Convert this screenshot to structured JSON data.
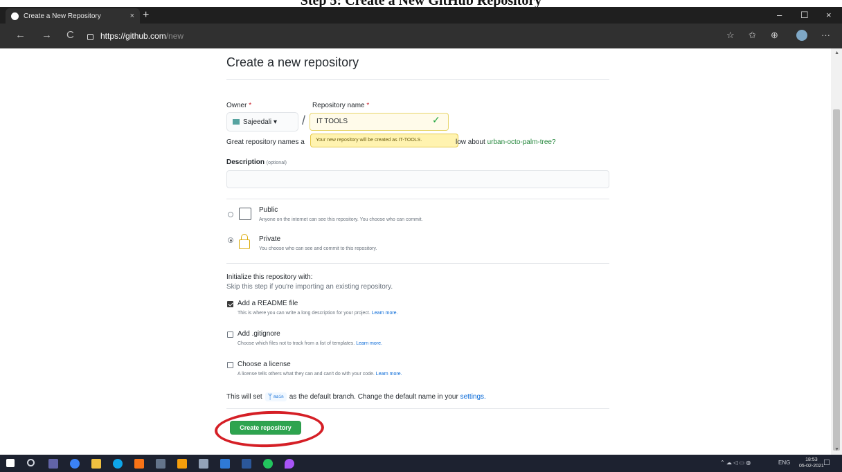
{
  "document_heading": "Step 5: Create a New GitHub Repository",
  "browser": {
    "tab_title": "Create a New Repository",
    "tab_close": "×",
    "new_tab": "+",
    "url_host": "https://github.com",
    "url_path": "/new",
    "nav": {
      "back": "←",
      "forward": "→",
      "reload": "C"
    },
    "window_controls": {
      "minimize": "–",
      "maximize": "☐",
      "close": "×"
    },
    "toolbar_icons": [
      "reading-list-icon",
      "favorites-icon",
      "collections-icon",
      "profile-icon",
      "more-icon"
    ],
    "more_label": "···"
  },
  "form": {
    "title": "Create a new repository",
    "owner_label": "Owner",
    "repo_name_label": "Repository name",
    "required_mark": "*",
    "owner_value": "Sajeedali",
    "owner_caret": "▾",
    "slash": "/",
    "repo_name_value": "IT TOOLS",
    "hint_prefix": "Great repository names a",
    "tooltip": "Your new repository will be created as IT-TOOLS.",
    "hint_suffix": "low about",
    "suggestion": "urban-octo-palm-tree?",
    "description_label": "Description",
    "description_optional": "(optional)",
    "description_value": "",
    "visibility": {
      "selected": "private",
      "public_title": "Public",
      "public_desc": "Anyone on the internet can see this repository. You choose who can commit.",
      "private_title": "Private",
      "private_desc": "You choose who can see and commit to this repository."
    },
    "init_title": "Initialize this repository with:",
    "init_subtitle": "Skip this step if you're importing an existing repository.",
    "options": [
      {
        "title": "Add a README file",
        "desc": "This is where you can write a long description for your project.",
        "learn": "Learn more.",
        "checked": true
      },
      {
        "title": "Add .gitignore",
        "desc": "Choose which files not to track from a list of templates.",
        "learn": "Learn more.",
        "checked": false
      },
      {
        "title": "Choose a license",
        "desc": "A license tells others what they can and can't do with your code.",
        "learn": "Learn more.",
        "checked": false
      }
    ],
    "branch_prefix": "This will set",
    "branch_name": "main",
    "branch_suffix": "as the default branch. Change the default name in your",
    "settings_link": "settings.",
    "submit": "Create repository"
  },
  "taskbar": {
    "tray_lang": "ENG",
    "time": "18:53",
    "date": "05-02-2021"
  },
  "colors": {
    "accent_green": "#2ea44f",
    "annotation_red": "#d51f26",
    "tooltip_yellow": "#fff3b0"
  }
}
